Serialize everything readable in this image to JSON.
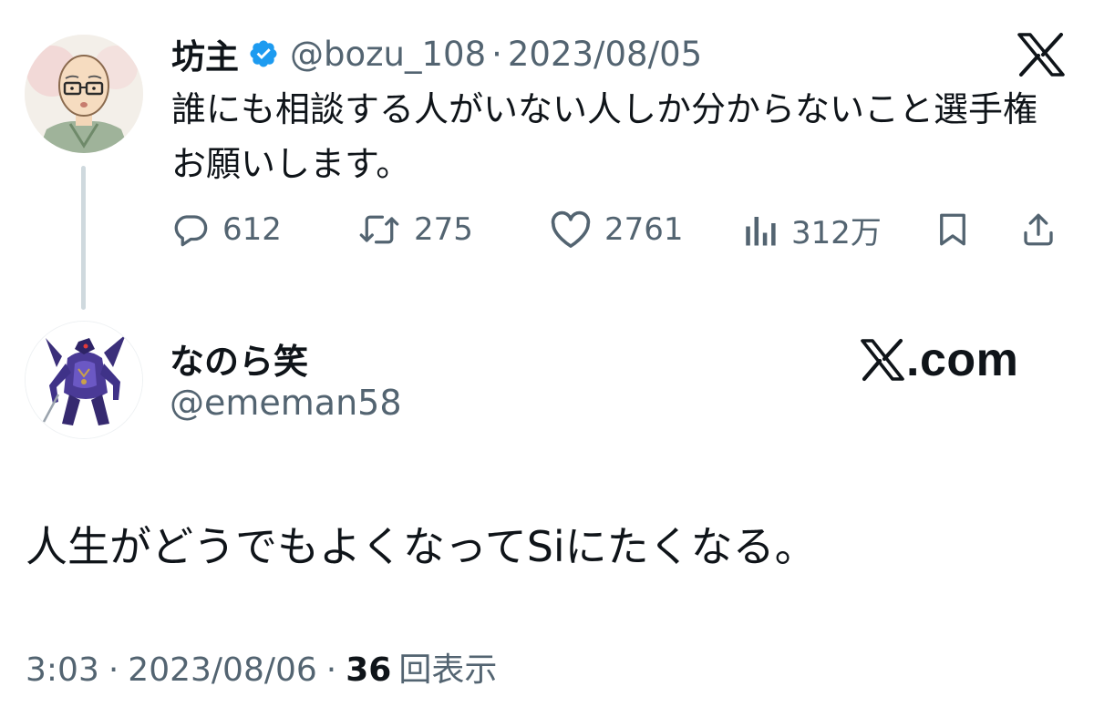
{
  "parent_tweet": {
    "display_name": "坊主",
    "verified": true,
    "handle": "@bozu_108",
    "separator": "·",
    "date": "2023/08/05",
    "text": "誰にも相談する人がいない人しか分からないこと選手権お願いします。",
    "replies": "612",
    "reposts": "275",
    "likes": "2761",
    "views": "312万",
    "logo_icon": "x-logo-icon",
    "accent_color": "#1d9bf0"
  },
  "reply_tweet": {
    "display_name": "なのら笑",
    "handle": "@ememan58",
    "watermark": ".com",
    "text": "人生がどうでもよくなってSiにたくなる。",
    "time": "3:03",
    "date": "2023/08/06",
    "separator": "·",
    "views_count": "36",
    "views_label": "回表示"
  }
}
